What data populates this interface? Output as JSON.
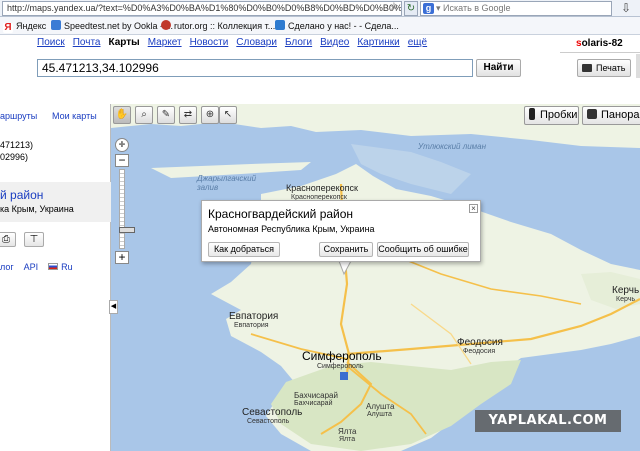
{
  "browser": {
    "url": "http://maps.yandex.ua/?text=%D0%A3%D0%BA%D1%80%D0%B0%D0%B8%D0%BD%D0%B0%2C%20%D0%9",
    "search_placeholder": "Искать в Google",
    "bookmarks": [
      {
        "label": "Яндекс",
        "icon": "yandex-icon",
        "color": "#e02020"
      },
      {
        "label": "Speedtest.net by Ookla - ...",
        "icon": "speedtest-icon",
        "color": "#3a7bd5"
      },
      {
        "label": "rutor.org :: Коллекция т...",
        "icon": "rutor-icon",
        "color": "#c0392b"
      },
      {
        "label": "Сделано у нас! - - Сдела...",
        "icon": "sdelano-icon",
        "color": "#2e7bd0"
      }
    ]
  },
  "header": {
    "services": [
      "Поиск",
      "Почта",
      "Карты",
      "Маркет",
      "Новости",
      "Словари",
      "Блоги",
      "Видео",
      "Картинки",
      "ещё"
    ],
    "active_service": "Карты",
    "username": "solaris-82",
    "query": "45.471213,34.102996",
    "find_label": "Найти",
    "print_label": "Печать"
  },
  "left_panel": {
    "tab_routes": "аршруты",
    "tab_mymaps": "Мои карты",
    "coord_line1": "471213)",
    "coord_line2": "02996)",
    "result_title": "й район",
    "result_subtitle": "ка Крым, Украина",
    "footer_links": [
      "лог",
      "API",
      "Ru"
    ]
  },
  "map": {
    "traffic_label": "Пробки",
    "panorama_label": "Панорамы",
    "balloon": {
      "title": "Красногвардейский район",
      "subtitle": "Автономная Республика Крым, Украина",
      "btn_route": "Как добраться",
      "btn_save": "Сохранить",
      "btn_report": "Сообщить об ошибке"
    },
    "labels": {
      "uzlyuk_liman": "Утлюкский лиман",
      "dzharylgach": "Джарылгачский залив",
      "krasnoperekopsk_1": "Красноперекопск",
      "krasnoperekopsk_2": "Красноперекопск",
      "kerch_1": "Керчь",
      "kerch_2": "Керчь",
      "evpatoria_1": "Евпатория",
      "evpatoria_2": "Евпатория",
      "simferopol_1": "Симферополь",
      "simferopol_2": "Симферополь",
      "feodosia_1": "Феодосия",
      "feodosia_2": "Феодосия",
      "bakhchisaray_1": "Бахчисарай",
      "bakhchisaray_2": "Бахчисарай",
      "sevastopol_1": "Севастополь",
      "sevastopol_2": "Севастополь",
      "alushta_1": "Алушта",
      "alushta_2": "Алушта",
      "yalta_1": "Ялта",
      "yalta_2": "Ялта"
    },
    "colors": {
      "sea": "#a9c6e8",
      "land": "#eef3e4",
      "mountains": "#d8e6c4",
      "roads": "#f5c04a"
    }
  },
  "watermark": "YAPLAKAL.COM"
}
